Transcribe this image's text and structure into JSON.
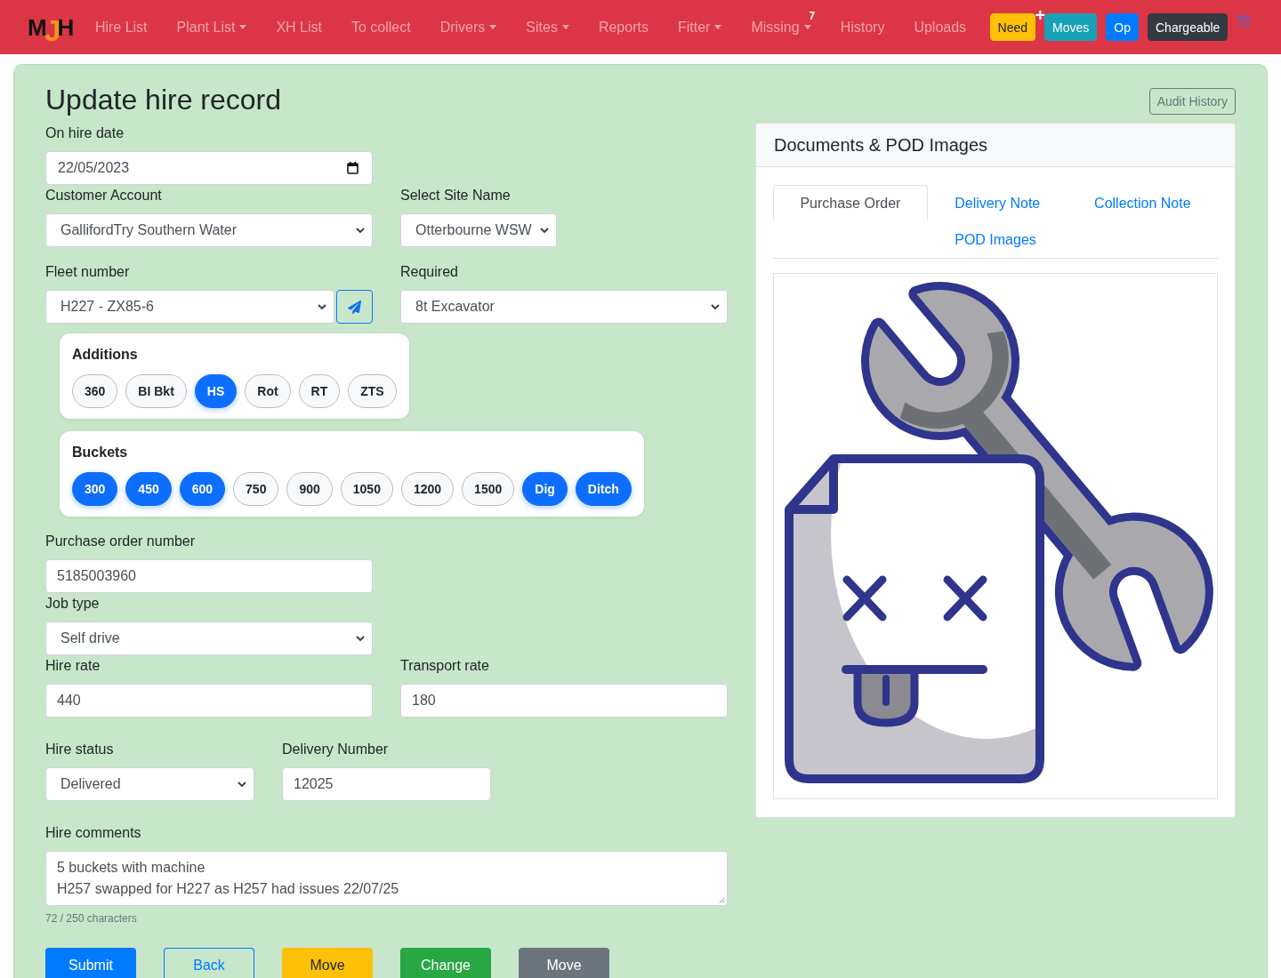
{
  "navbar": {
    "brand": "MJH",
    "links": [
      {
        "label": "Hire List",
        "dropdown": false
      },
      {
        "label": "Plant List",
        "dropdown": true
      },
      {
        "label": "XH List",
        "dropdown": false
      },
      {
        "label": "To collect",
        "dropdown": false
      },
      {
        "label": "Drivers",
        "dropdown": true
      },
      {
        "label": "Sites",
        "dropdown": true
      },
      {
        "label": "Reports",
        "dropdown": false
      },
      {
        "label": "Fitter",
        "dropdown": true
      },
      {
        "label": "Missing",
        "dropdown": true,
        "badge": "7"
      },
      {
        "label": "History",
        "dropdown": false
      },
      {
        "label": "Uploads",
        "dropdown": false
      }
    ],
    "buttons": [
      {
        "label": "Need",
        "kind": "warning",
        "badge": "+"
      },
      {
        "label": "Moves",
        "kind": "info"
      },
      {
        "label": "Op",
        "kind": "primary"
      },
      {
        "label": "Chargeable",
        "kind": "dark"
      }
    ]
  },
  "page": {
    "title": "Update hire record",
    "audit_button": "Audit History"
  },
  "form": {
    "hire_date": {
      "label": "On hire date",
      "kind": "date",
      "value": "22/05/2023"
    },
    "customer_account": {
      "label": "Customer Account",
      "kind": "select",
      "value": "GallifordTry Southern Water"
    },
    "site_name": {
      "label": "Select Site Name",
      "kind": "select",
      "value": "Otterbourne WSW"
    },
    "fleet_number": {
      "label": "Fleet number",
      "kind": "select-send",
      "value": "H227 - ZX85-6"
    },
    "required": {
      "label": "Required",
      "kind": "select",
      "value": "8t Excavator"
    },
    "additions": {
      "title": "Additions",
      "options": [
        {
          "label": "360",
          "selected": false
        },
        {
          "label": "BI Bkt",
          "selected": false
        },
        {
          "label": "HS",
          "selected": true
        },
        {
          "label": "Rot",
          "selected": false
        },
        {
          "label": "RT",
          "selected": false
        },
        {
          "label": "ZTS",
          "selected": false
        }
      ]
    },
    "buckets": {
      "title": "Buckets",
      "options": [
        {
          "label": "300",
          "selected": true
        },
        {
          "label": "450",
          "selected": true
        },
        {
          "label": "600",
          "selected": true
        },
        {
          "label": "750",
          "selected": false
        },
        {
          "label": "900",
          "selected": false
        },
        {
          "label": "1050",
          "selected": false
        },
        {
          "label": "1200",
          "selected": false
        },
        {
          "label": "1500",
          "selected": false
        },
        {
          "label": "Dig",
          "selected": true
        },
        {
          "label": "Ditch",
          "selected": true
        }
      ]
    },
    "purchase_order_number": {
      "label": "Purchase order number",
      "kind": "input",
      "value": "5185003960"
    },
    "job_type": {
      "label": "Job type",
      "kind": "select",
      "value": "Self drive"
    },
    "hire_rate": {
      "label": "Hire rate",
      "kind": "input",
      "value": "440"
    },
    "transport_rate": {
      "label": "Transport rate",
      "kind": "input",
      "value": "180"
    },
    "hire_status": {
      "label": "Hire status",
      "kind": "select",
      "value": "Delivered"
    },
    "delivery_number": {
      "label": "Delivery Number",
      "kind": "input",
      "value": "12025"
    },
    "hire_comments": {
      "label": "Hire comments",
      "kind": "textarea",
      "value": "5 buckets with machine\nH257 swapped for H227 as H257 had issues 22/07/25",
      "counter": "72 / 250 characters"
    }
  },
  "actions": [
    {
      "label": "Submit",
      "kind": "primary"
    },
    {
      "label": "Back",
      "kind": "outline-primary"
    },
    {
      "label": "Move",
      "kind": "warning"
    },
    {
      "label": "Change",
      "kind": "success"
    },
    {
      "label": "Move",
      "kind": "secondary"
    }
  ],
  "documents": {
    "title": "Documents & POD Images",
    "tabs": [
      {
        "label": "Purchase Order",
        "selected": true
      },
      {
        "label": "Delivery Note",
        "selected": false
      },
      {
        "label": "Collection Note",
        "selected": false
      },
      {
        "label": "POD Images",
        "selected": false
      }
    ]
  }
}
